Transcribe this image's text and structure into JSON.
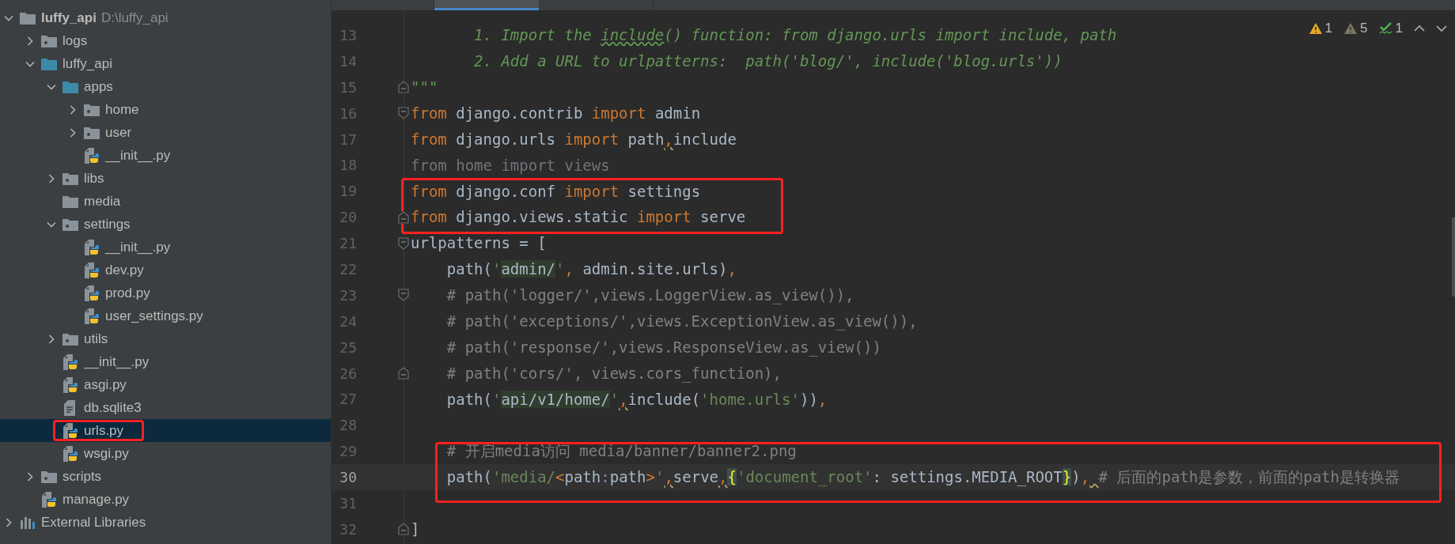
{
  "project_tree": {
    "name": "luffy_api",
    "kind": "folder",
    "path": "D:\\luffy_api",
    "expanded": true,
    "selected": false,
    "children": [
      {
        "name": "logs",
        "kind": "package",
        "expanded": false,
        "selected": false
      },
      {
        "name": "luffy_api",
        "kind": "source",
        "expanded": true,
        "selected": false,
        "children": [
          {
            "name": "apps",
            "kind": "source",
            "expanded": true,
            "selected": false,
            "children": [
              {
                "name": "home",
                "kind": "package",
                "expanded": false,
                "selected": false
              },
              {
                "name": "user",
                "kind": "package",
                "expanded": false,
                "selected": false
              },
              {
                "name": "__init__.py",
                "kind": "python",
                "selected": false
              }
            ]
          },
          {
            "name": "libs",
            "kind": "package",
            "expanded": false,
            "selected": false
          },
          {
            "name": "media",
            "kind": "folder",
            "selected": false
          },
          {
            "name": "settings",
            "kind": "package",
            "expanded": true,
            "selected": false,
            "children": [
              {
                "name": "__init__.py",
                "kind": "python",
                "selected": false
              },
              {
                "name": "dev.py",
                "kind": "python",
                "selected": false
              },
              {
                "name": "prod.py",
                "kind": "python",
                "selected": false
              },
              {
                "name": "user_settings.py",
                "kind": "python",
                "selected": false
              }
            ]
          },
          {
            "name": "utils",
            "kind": "package",
            "expanded": false,
            "selected": false
          },
          {
            "name": "__init__.py",
            "kind": "python",
            "selected": false
          },
          {
            "name": "asgi.py",
            "kind": "python",
            "selected": false
          },
          {
            "name": "db.sqlite3",
            "kind": "text",
            "selected": false
          },
          {
            "name": "urls.py",
            "kind": "python",
            "selected": true
          },
          {
            "name": "wsgi.py",
            "kind": "python",
            "selected": false
          }
        ]
      },
      {
        "name": "scripts",
        "kind": "package",
        "expanded": false,
        "selected": false
      },
      {
        "name": "manage.py",
        "kind": "python",
        "selected": false
      }
    ]
  },
  "external_libraries": {
    "name": "External Libraries",
    "expanded": false
  },
  "inspections": {
    "warning_count": "1",
    "weak_warning_count": "5",
    "typo_count": "1"
  },
  "editor_lines": [
    {
      "number": "13",
      "current": false,
      "tokens": [
        {
          "kind": "doc",
          "text": "       1. Import the "
        },
        {
          "kind": "doc-warn",
          "text": "include"
        },
        {
          "kind": "doc",
          "text": "() function: from django.urls import include, path"
        }
      ]
    },
    {
      "number": "14",
      "current": false,
      "tokens": [
        {
          "kind": "doc",
          "text": "       2. Add a URL to urlpatterns:  path('blog/', include('blog.urls'))"
        }
      ]
    },
    {
      "number": "15",
      "current": false,
      "fold": {
        "kind": "close"
      },
      "tokens": [
        {
          "kind": "doc",
          "text": "\"\"\""
        }
      ]
    },
    {
      "number": "16",
      "current": false,
      "fold": {
        "kind": "open"
      },
      "tokens": [
        {
          "kind": "kw",
          "text": "from"
        },
        {
          "kind": "text",
          "text": " django.contrib "
        },
        {
          "kind": "kw",
          "text": "import"
        },
        {
          "kind": "text",
          "text": " admin"
        }
      ]
    },
    {
      "number": "17",
      "current": false,
      "tokens": [
        {
          "kind": "kw",
          "text": "from"
        },
        {
          "kind": "text",
          "text": " django.urls "
        },
        {
          "kind": "kw",
          "text": "import"
        },
        {
          "kind": "text",
          "text": " path"
        },
        {
          "kind": "lead-comma-warn",
          "text": ",include"
        }
      ]
    },
    {
      "number": "18",
      "current": false,
      "tokens": [
        {
          "kind": "unused",
          "text": "from home import views"
        }
      ]
    },
    {
      "number": "19",
      "current": false,
      "tokens": [
        {
          "kind": "kw",
          "text": "from"
        },
        {
          "kind": "text",
          "text": " django.conf "
        },
        {
          "kind": "kw",
          "text": "import"
        },
        {
          "kind": "text",
          "text": " settings"
        }
      ]
    },
    {
      "number": "20",
      "current": false,
      "fold": {
        "kind": "close"
      },
      "tokens": [
        {
          "kind": "kw",
          "text": "from"
        },
        {
          "kind": "text",
          "text": " django.views.static "
        },
        {
          "kind": "kw",
          "text": "import"
        },
        {
          "kind": "text",
          "text": " serve"
        }
      ]
    },
    {
      "number": "21",
      "current": false,
      "fold": {
        "kind": "open"
      },
      "tokens": [
        {
          "kind": "text",
          "text": "urlpatterns = ["
        }
      ]
    },
    {
      "number": "22",
      "current": false,
      "tokens": [
        {
          "kind": "text",
          "text": "    path("
        },
        {
          "kind": "string",
          "text": "'"
        },
        {
          "kind": "url",
          "text": "admin/"
        },
        {
          "kind": "string",
          "text": "'"
        },
        {
          "kind": "comma",
          "text": ","
        },
        {
          "kind": "text",
          "text": " admin.site.urls)"
        },
        {
          "kind": "comma",
          "text": ","
        }
      ]
    },
    {
      "number": "23",
      "current": false,
      "fold": {
        "kind": "open"
      },
      "tokens": [
        {
          "kind": "comment",
          "text": "    # path('logger/',views.LoggerView.as_view()),"
        }
      ]
    },
    {
      "number": "24",
      "current": false,
      "tokens": [
        {
          "kind": "comment",
          "text": "    # path('exceptions/',views.ExceptionView.as_view()),"
        }
      ]
    },
    {
      "number": "25",
      "current": false,
      "tokens": [
        {
          "kind": "comment",
          "text": "    # path('response/',views.ResponseView.as_view())"
        }
      ]
    },
    {
      "number": "26",
      "current": false,
      "fold": {
        "kind": "close"
      },
      "tokens": [
        {
          "kind": "comment",
          "text": "    # path('cors/', views.cors_function),"
        }
      ]
    },
    {
      "number": "27",
      "current": false,
      "tokens": [
        {
          "kind": "text",
          "text": "    path("
        },
        {
          "kind": "string",
          "text": "'"
        },
        {
          "kind": "url",
          "text": "api/v1/home/"
        },
        {
          "kind": "string",
          "text": "'"
        },
        {
          "kind": "comma-warn",
          "text": ","
        },
        {
          "kind": "text",
          "text": "include("
        },
        {
          "kind": "string",
          "text": "'home.urls'"
        },
        {
          "kind": "text",
          "text": "))"
        },
        {
          "kind": "comma",
          "text": ","
        }
      ]
    },
    {
      "number": "28",
      "current": false
    },
    {
      "number": "29",
      "current": false,
      "tokens": [
        {
          "kind": "comment",
          "text": "    # 开启media访问 media/banner/banner2.png"
        }
      ]
    },
    {
      "number": "30",
      "current": true,
      "tokens": [
        {
          "kind": "text",
          "text": "    path("
        },
        {
          "kind": "string",
          "text": "'media/"
        },
        {
          "kind": "angle",
          "text": "<"
        },
        {
          "kind": "text",
          "text": "path"
        },
        {
          "kind": "op",
          "text": ":"
        },
        {
          "kind": "text",
          "text": "path"
        },
        {
          "kind": "angle",
          "text": ">"
        },
        {
          "kind": "string",
          "text": "'"
        },
        {
          "kind": "comma-warn",
          "text": ","
        },
        {
          "kind": "text",
          "text": "serve"
        },
        {
          "kind": "comma-warn",
          "text": ","
        },
        {
          "kind": "brace",
          "text": "{"
        },
        {
          "kind": "string",
          "text": "'document_root'"
        },
        {
          "kind": "text",
          "text": ": settings.MEDIA_ROOT"
        },
        {
          "kind": "brace",
          "text": "}"
        },
        {
          "kind": "text",
          "text": ")"
        },
        {
          "kind": "comma-gap-warn",
          "text": ","
        },
        {
          "kind": "comment",
          "text": "# 后面的path是参数，前面的path是转换器"
        }
      ]
    },
    {
      "number": "31",
      "current": false
    },
    {
      "number": "32",
      "current": false,
      "fold": {
        "kind": "close"
      },
      "tokens": [
        {
          "kind": "text",
          "text": "]"
        }
      ]
    }
  ]
}
